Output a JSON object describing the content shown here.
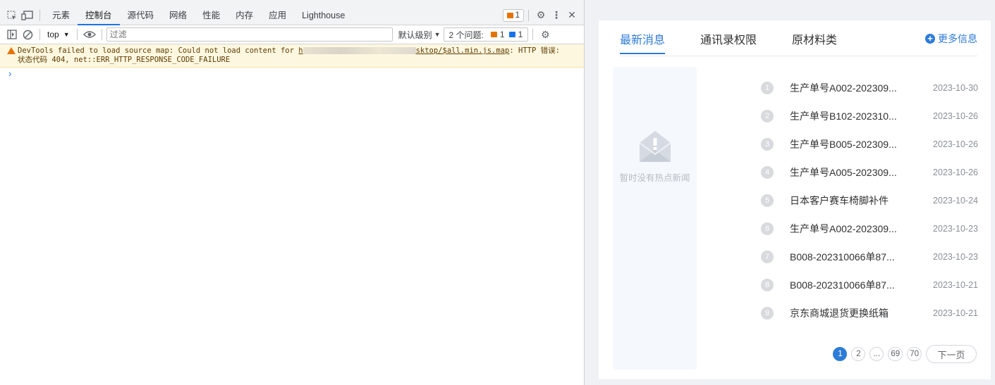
{
  "devtools": {
    "tabs": [
      "元素",
      "控制台",
      "源代码",
      "网络",
      "性能",
      "内存",
      "应用",
      "Lighthouse"
    ],
    "active_tab": "控制台",
    "issue_badge_count": "1",
    "console": {
      "context": "top",
      "filter_placeholder": "过滤",
      "level": "默认级别",
      "issues_label": "2 个问题:",
      "issues_warning_count": "1",
      "issues_info_count": "1",
      "warning": {
        "text_pre": "DevTools failed to load source map: Could not load content for ",
        "link_start": "h",
        "link_end": "sktop/$all.min.js.map",
        "text_post": ": HTTP 错误: 状态代码 404, net::ERR_HTTP_RESPONSE_CODE_FAILURE"
      },
      "prompt": "›"
    }
  },
  "webpage": {
    "tabs": [
      "最新消息",
      "通讯录权限",
      "原材料类"
    ],
    "active_tab": "最新消息",
    "more": "更多信息",
    "hot_empty": "暂时没有热点新闻",
    "news": [
      {
        "num": "1",
        "title": "生产单号A002-202309...",
        "date": "2023-10-30"
      },
      {
        "num": "2",
        "title": "生产单号B102-202310...",
        "date": "2023-10-26"
      },
      {
        "num": "3",
        "title": "生产单号B005-202309...",
        "date": "2023-10-26"
      },
      {
        "num": "4",
        "title": "生产单号A005-202309...",
        "date": "2023-10-26"
      },
      {
        "num": "5",
        "title": "日本客户赛车椅脚补件",
        "date": "2023-10-24"
      },
      {
        "num": "6",
        "title": "生产单号A002-202309...",
        "date": "2023-10-23"
      },
      {
        "num": "7",
        "title": "B008-202310066单87...",
        "date": "2023-10-23"
      },
      {
        "num": "8",
        "title": "B008-202310066单87...",
        "date": "2023-10-21"
      },
      {
        "num": "9",
        "title": "京东商城退货更换纸箱",
        "date": "2023-10-21"
      }
    ],
    "pagination": {
      "pages": [
        "1",
        "2",
        "...",
        "69",
        "70"
      ],
      "current": "1",
      "next": "下一页"
    },
    "colors": {
      "accent": "#2d7bd8",
      "page_bg": "#eff1f4"
    }
  }
}
